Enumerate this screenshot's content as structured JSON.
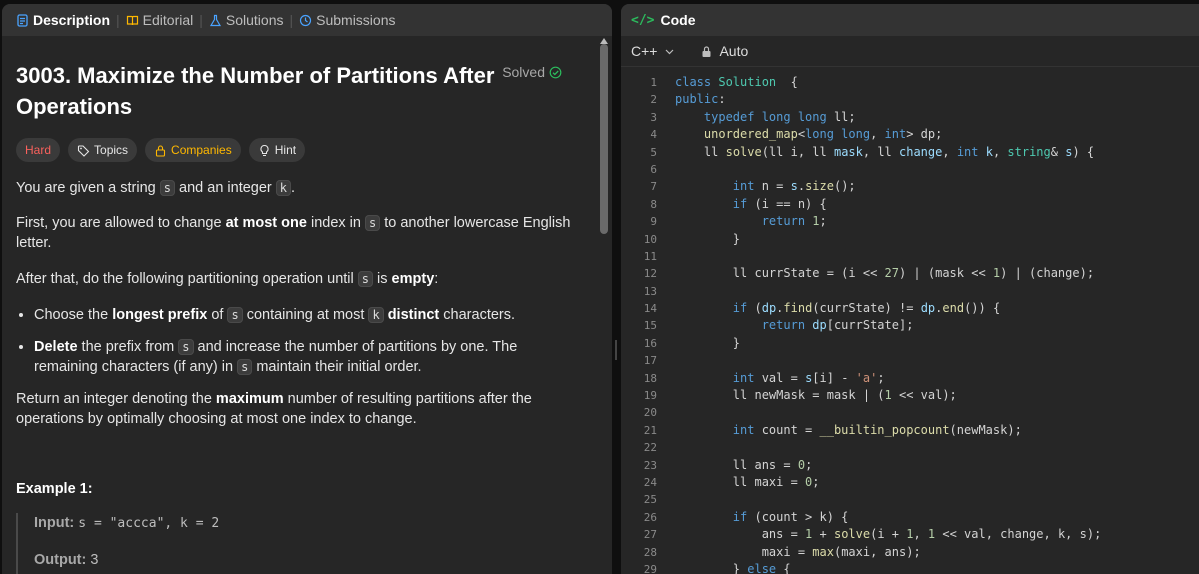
{
  "tabs": {
    "description": "Description",
    "editorial": "Editorial",
    "solutions": "Solutions",
    "submissions": "Submissions"
  },
  "problem": {
    "title": "3003. Maximize the Number of Partitions After Operations",
    "solved": "Solved",
    "difficulty": "Hard",
    "chips": {
      "topics": "Topics",
      "companies": "Companies",
      "hint": "Hint"
    }
  },
  "description": {
    "p1_a": "You are given a string ",
    "p1_code1": "s",
    "p1_b": " and an integer ",
    "p1_code2": "k",
    "p1_c": ".",
    "p2_a": "First, you are allowed to change ",
    "p2_bold": "at most one",
    "p2_b": " index in ",
    "p2_code": "s",
    "p2_c": " to another lowercase English letter.",
    "p3_a": "After that, do the following partitioning operation until ",
    "p3_code": "s",
    "p3_b": " is ",
    "p3_bold": "empty",
    "p3_c": ":",
    "li1_a": "Choose the ",
    "li1_bold1": "longest",
    "li1_sp": " ",
    "li1_bold2": "prefix",
    "li1_b": " of ",
    "li1_code1": "s",
    "li1_c": " containing at most ",
    "li1_code2": "k",
    "li1_d": " ",
    "li1_bold3": "distinct",
    "li1_e": " characters.",
    "li2_bold": "Delete",
    "li2_a": " the prefix from ",
    "li2_code1": "s",
    "li2_b": " and increase the number of partitions by one. The remaining characters (if any) in ",
    "li2_code2": "s",
    "li2_c": " maintain their initial order.",
    "p4_a": "Return an integer denoting the ",
    "p4_bold": "maximum",
    "p4_b": " number of resulting partitions after the operations by optimally choosing at most one index to change."
  },
  "example": {
    "title": "Example 1:",
    "input_label": "Input:",
    "input_value": "s = \"accca\", k = 2",
    "output_label": "Output:",
    "output_value": "3"
  },
  "code_panel": {
    "title": "Code",
    "language": "C++",
    "mode": "Auto"
  },
  "code_lines": [
    {
      "n": "1",
      "t": [
        [
          "kw",
          "class "
        ],
        [
          "cls",
          "Solution"
        ],
        [
          "",
          "  {"
        ]
      ]
    },
    {
      "n": "2",
      "t": [
        [
          "kw",
          "public"
        ],
        [
          "",
          ":"
        ]
      ]
    },
    {
      "n": "3",
      "t": [
        [
          "",
          "    "
        ],
        [
          "kw",
          "typedef long long "
        ],
        [
          "",
          "ll;"
        ]
      ]
    },
    {
      "n": "4",
      "t": [
        [
          "",
          "    "
        ],
        [
          "fn",
          "unordered_map"
        ],
        [
          "",
          "<"
        ],
        [
          "kw",
          "long long"
        ],
        [
          "",
          ", "
        ],
        [
          "kw",
          "int"
        ],
        [
          "",
          "> dp;"
        ]
      ]
    },
    {
      "n": "5",
      "t": [
        [
          "",
          "    "
        ],
        [
          "",
          "ll "
        ],
        [
          "fn",
          "solve"
        ],
        [
          "",
          "(ll i, ll "
        ],
        [
          "var",
          "mask"
        ],
        [
          "",
          ", ll "
        ],
        [
          "var",
          "change"
        ],
        [
          "",
          ", "
        ],
        [
          "kw",
          "int "
        ],
        [
          "var",
          "k"
        ],
        [
          "",
          ", "
        ],
        [
          "cls",
          "string"
        ],
        [
          "",
          "& "
        ],
        [
          "var",
          "s"
        ],
        [
          "",
          ") {"
        ]
      ]
    },
    {
      "n": "6",
      "t": [
        [
          "",
          ""
        ]
      ]
    },
    {
      "n": "7",
      "t": [
        [
          "",
          "        "
        ],
        [
          "kw",
          "int "
        ],
        [
          "",
          "n = "
        ],
        [
          "var",
          "s"
        ],
        [
          "",
          "."
        ],
        [
          "fn",
          "size"
        ],
        [
          "",
          "();"
        ]
      ]
    },
    {
      "n": "8",
      "t": [
        [
          "",
          "        "
        ],
        [
          "kw",
          "if "
        ],
        [
          "",
          "(i == n) {"
        ]
      ]
    },
    {
      "n": "9",
      "t": [
        [
          "",
          "            "
        ],
        [
          "kw",
          "return "
        ],
        [
          "num",
          "1"
        ],
        [
          "",
          ";"
        ]
      ]
    },
    {
      "n": "10",
      "t": [
        [
          "",
          "        }"
        ]
      ]
    },
    {
      "n": "11",
      "t": [
        [
          "",
          ""
        ]
      ]
    },
    {
      "n": "12",
      "t": [
        [
          "",
          "        ll currState = (i << "
        ],
        [
          "num",
          "27"
        ],
        [
          "",
          ") | (mask << "
        ],
        [
          "num",
          "1"
        ],
        [
          "",
          ") | (change);"
        ]
      ]
    },
    {
      "n": "13",
      "t": [
        [
          "",
          ""
        ]
      ]
    },
    {
      "n": "14",
      "t": [
        [
          "",
          "        "
        ],
        [
          "kw",
          "if "
        ],
        [
          "",
          "("
        ],
        [
          "var",
          "dp"
        ],
        [
          "",
          "."
        ],
        [
          "fn",
          "find"
        ],
        [
          "",
          "(currState) != "
        ],
        [
          "var",
          "dp"
        ],
        [
          "",
          "."
        ],
        [
          "fn",
          "end"
        ],
        [
          "",
          "()) {"
        ]
      ]
    },
    {
      "n": "15",
      "t": [
        [
          "",
          "            "
        ],
        [
          "kw",
          "return "
        ],
        [
          "var",
          "dp"
        ],
        [
          "",
          "[currState];"
        ]
      ]
    },
    {
      "n": "16",
      "t": [
        [
          "",
          "        }"
        ]
      ]
    },
    {
      "n": "17",
      "t": [
        [
          "",
          ""
        ]
      ]
    },
    {
      "n": "18",
      "t": [
        [
          "",
          "        "
        ],
        [
          "kw",
          "int "
        ],
        [
          "",
          "val = "
        ],
        [
          "var",
          "s"
        ],
        [
          "",
          "[i] - "
        ],
        [
          "str",
          "'a'"
        ],
        [
          "",
          ";"
        ]
      ]
    },
    {
      "n": "19",
      "t": [
        [
          "",
          "        ll newMask = mask | ("
        ],
        [
          "num",
          "1"
        ],
        [
          "",
          " << val);"
        ]
      ]
    },
    {
      "n": "20",
      "t": [
        [
          "",
          ""
        ]
      ]
    },
    {
      "n": "21",
      "t": [
        [
          "",
          "        "
        ],
        [
          "kw",
          "int "
        ],
        [
          "",
          "count = "
        ],
        [
          "fn",
          "__builtin_popcount"
        ],
        [
          "",
          "(newMask);"
        ]
      ]
    },
    {
      "n": "22",
      "t": [
        [
          "",
          ""
        ]
      ]
    },
    {
      "n": "23",
      "t": [
        [
          "",
          "        ll ans = "
        ],
        [
          "num",
          "0"
        ],
        [
          "",
          ";"
        ]
      ]
    },
    {
      "n": "24",
      "t": [
        [
          "",
          "        ll maxi = "
        ],
        [
          "num",
          "0"
        ],
        [
          "",
          ";"
        ]
      ]
    },
    {
      "n": "25",
      "t": [
        [
          "",
          ""
        ]
      ]
    },
    {
      "n": "26",
      "t": [
        [
          "",
          "        "
        ],
        [
          "kw",
          "if "
        ],
        [
          "",
          "(count > k) {"
        ]
      ]
    },
    {
      "n": "27",
      "t": [
        [
          "",
          "            ans = "
        ],
        [
          "num",
          "1"
        ],
        [
          "",
          " + "
        ],
        [
          "fn",
          "solve"
        ],
        [
          "",
          "(i + "
        ],
        [
          "num",
          "1"
        ],
        [
          "",
          ", "
        ],
        [
          "num",
          "1"
        ],
        [
          "",
          " << val, change, k, s);"
        ]
      ]
    },
    {
      "n": "28",
      "t": [
        [
          "",
          "            maxi = "
        ],
        [
          "fn",
          "max"
        ],
        [
          "",
          "(maxi, ans);"
        ]
      ]
    },
    {
      "n": "29",
      "t": [
        [
          "",
          "        } "
        ],
        [
          "kw",
          "else "
        ],
        [
          "",
          "{"
        ]
      ]
    }
  ],
  "colors": {
    "hard": "#f8615c",
    "companies": "#ffb800",
    "solved_check": "#2cbb5d",
    "keyword": "#569cd6",
    "accent_code_icon": "#2cbb5d"
  }
}
